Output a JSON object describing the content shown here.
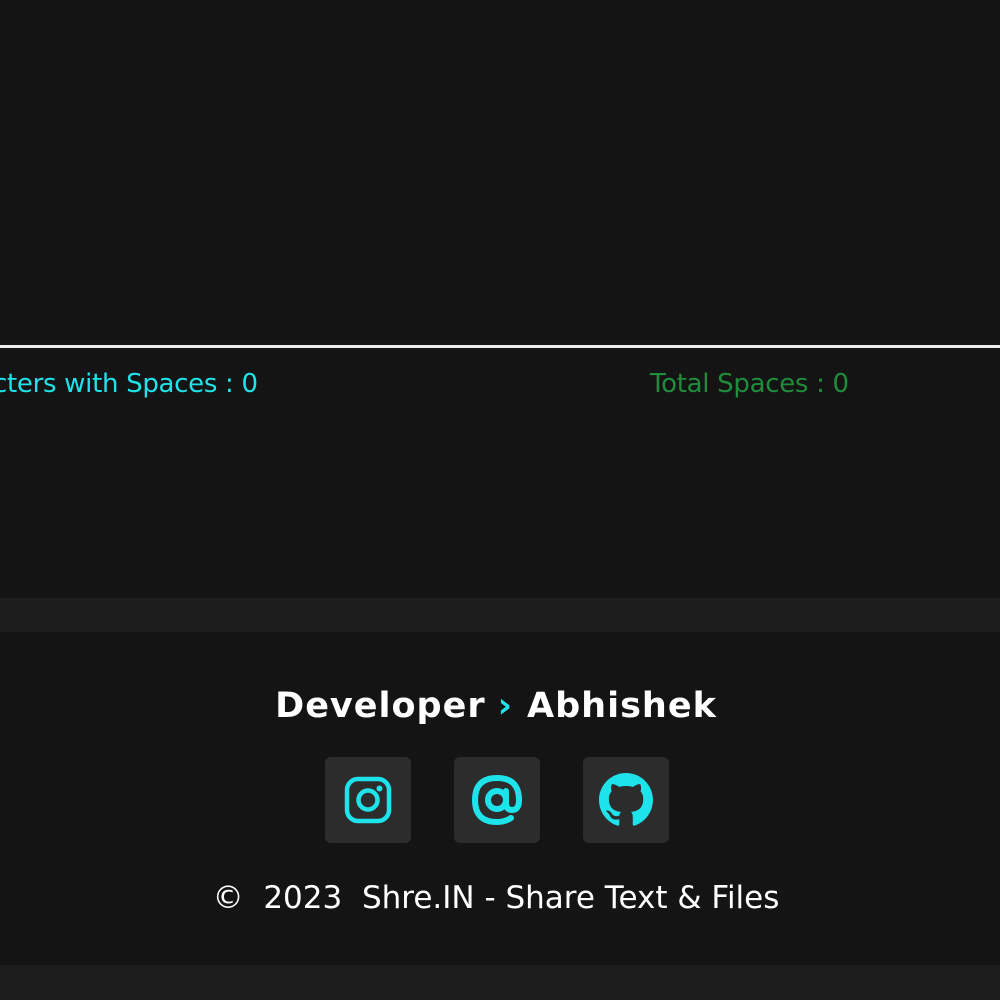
{
  "editor": {
    "value": ""
  },
  "stats": {
    "chars_with_spaces": "cters with Spaces : 0",
    "total_spaces": "Total Spaces : 0"
  },
  "footer": {
    "developer_label": "Developer",
    "chevron": "›",
    "developer_name": "Abhishek",
    "socials": [
      {
        "icon": "instagram-icon"
      },
      {
        "icon": "at-sign-icon"
      },
      {
        "icon": "github-icon"
      }
    ],
    "copyright_symbol": "©",
    "year": "2023",
    "site_text": "Shre.IN - Share Text & Files"
  },
  "colors": {
    "accent": "#1fe3ea",
    "spaces_text": "#1f8c3b",
    "background": "#141415",
    "icon_tile": "#2c2c2d"
  }
}
